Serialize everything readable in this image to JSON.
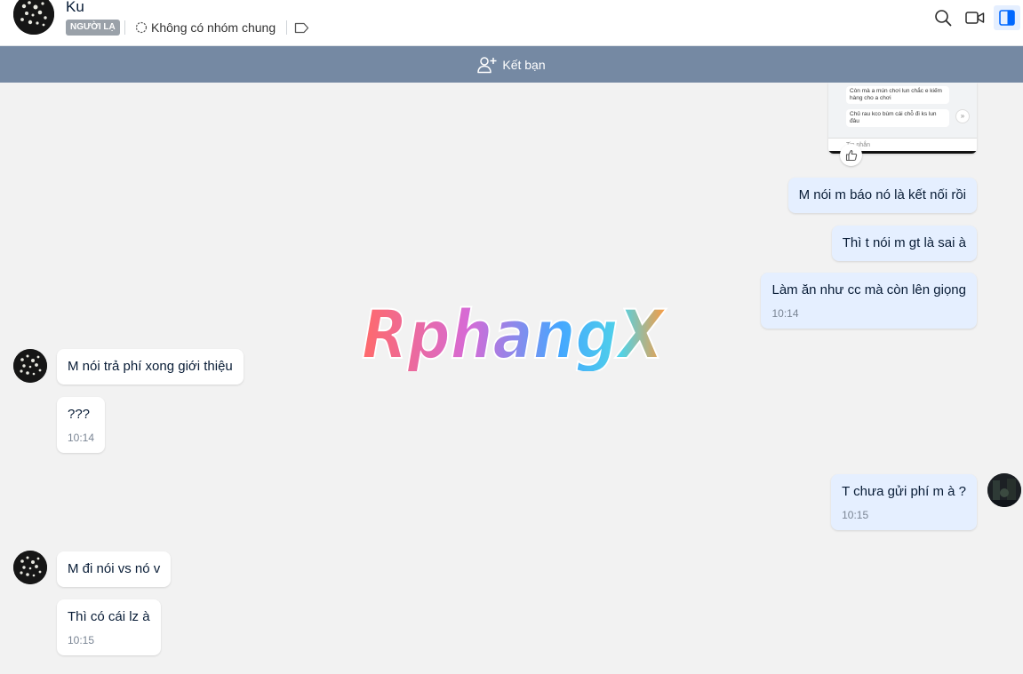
{
  "header": {
    "contact_name": "Ku",
    "badge": "NGƯỜI LẠ",
    "group_info": "Không có nhóm chung",
    "icons": [
      "search-icon",
      "video-call-icon",
      "sidebar-toggle-icon"
    ]
  },
  "friend_bar": {
    "label": "Kết bạn",
    "icon": "add-friend-icon"
  },
  "preview": {
    "line1": "Còn mà a mún chơi lun chắc e kiếm",
    "line2": "hàng cho a chơi",
    "line3": "Chủ rau kco bùm cái chỗ đi ks lun",
    "line4": "đâu",
    "input_placeholder": "Tin nhắn"
  },
  "watermark": "RphangX",
  "messages": [
    {
      "dir": "out",
      "text": "M nói m báo nó là kết nối rồi"
    },
    {
      "dir": "out",
      "text": "Thì t nói m gt là sai à"
    },
    {
      "dir": "out",
      "text": "Làm ăn như cc mà còn lên giọng",
      "time": "10:14"
    },
    {
      "dir": "in",
      "text": "M nói trả phí xong giới thiệu"
    },
    {
      "dir": "in",
      "text": "???",
      "time": "10:14"
    },
    {
      "dir": "out",
      "text": "T chưa gửi phí m à ?",
      "time": "10:15"
    },
    {
      "dir": "in",
      "text": "M đi nói vs nó v"
    },
    {
      "dir": "in",
      "text": "Thì có cái lz à",
      "time": "10:15"
    }
  ],
  "colors": {
    "friend_bar": "#7589a3",
    "outgoing_bubble": "#e5efff",
    "incoming_bubble": "#ffffff",
    "background": "#f2f2f2"
  }
}
